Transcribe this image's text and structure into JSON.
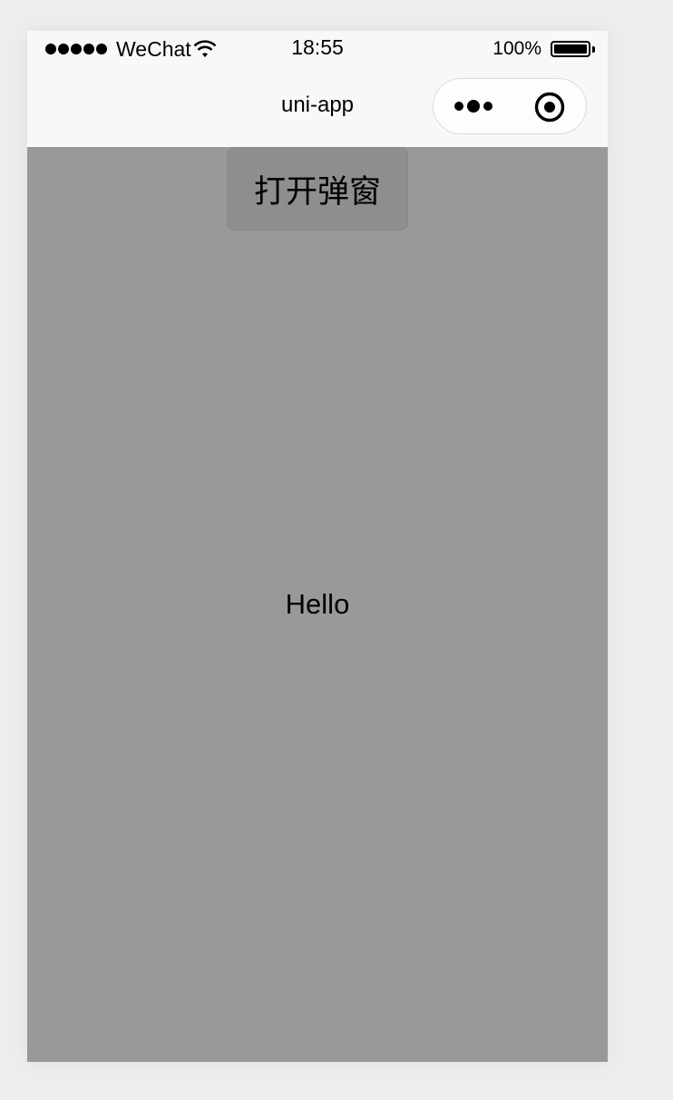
{
  "status_bar": {
    "carrier": "WeChat",
    "time": "18:55",
    "battery_level": "100%",
    "battery_fraction": 1.0,
    "signal_icon": "signal-dots-icon",
    "wifi_icon": "wifi-icon",
    "battery_icon": "battery-icon"
  },
  "nav_bar": {
    "title": "uni-app",
    "more_icon": "more-dots-icon",
    "close_icon": "target-close-icon"
  },
  "content": {
    "open_popup_label": "打开弹窗",
    "hello_text": "Hello"
  },
  "colors": {
    "page_background": "#ededeb",
    "overlay_mask": "#999999",
    "nav_background": "#f8f8f8",
    "text": "#000000"
  }
}
